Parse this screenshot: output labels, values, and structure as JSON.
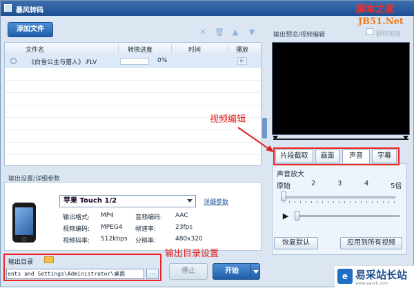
{
  "window": {
    "title": "暴风转码"
  },
  "watermark": {
    "top": "脚本之家",
    "jb": "JB51.Net"
  },
  "toolbar": {
    "add_file": "添加文件",
    "icons": [
      "close-icon",
      "delete-icon",
      "move-up-icon",
      "move-down-icon"
    ]
  },
  "file_list": {
    "columns": [
      "文件名",
      "转换进度",
      "时间",
      "播放"
    ],
    "rows": [
      {
        "name": "《白雪公主与猎人》.FLV",
        "progress": "0%",
        "progress_value": 0,
        "time": ""
      }
    ]
  },
  "output": {
    "section_label": "输出设置/详细参数",
    "device": "苹果 Touch 1/2",
    "detail_link": "详细参数",
    "params": {
      "format_label": "输出格式:",
      "format_value": "MP4",
      "acodec_label": "音频编码:",
      "acodec_value": "AAC",
      "vcodec_label": "视频编码:",
      "vcodec_value": "MPEG4",
      "fps_label": "帧速率:",
      "fps_value": "23fps",
      "vbitrate_label": "视频码率:",
      "vbitrate_value": "512kbps",
      "res_label": "分辨率:",
      "res_value": "480x320"
    },
    "dir_label": "输出目录",
    "dir_value": "ents and Settings\\Administrator\\桌面",
    "browse_label": "..."
  },
  "actions": {
    "stop": "停止",
    "start": "开始"
  },
  "annotations": {
    "video_edit": "视频编辑",
    "output_dir": "输出目录设置"
  },
  "preview": {
    "title": "输出预览/视频编辑",
    "crop_label": "翻转画面",
    "tabs": [
      "片段截取",
      "画面",
      "声音",
      "字幕"
    ],
    "active_tab": "声音",
    "volume_label": "声音放大",
    "volume_ticks": [
      "原始",
      "2",
      "3",
      "4",
      "5倍"
    ],
    "volume_level": 1,
    "reset": "恢复默认",
    "apply_all": "应用到所有视频"
  },
  "site_logo": {
    "name": "易采站长站",
    "url": "www.easck.com"
  },
  "colors": {
    "accent": "#1f5fa9",
    "annotation": "#e21f1f",
    "title_bar": "#2a5d9f"
  }
}
